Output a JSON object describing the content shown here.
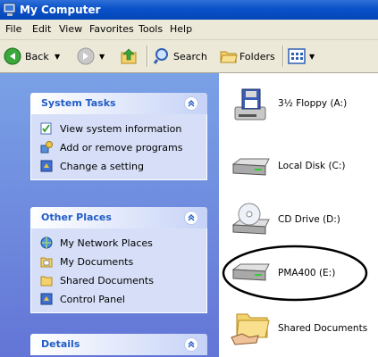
{
  "window": {
    "title": "My Computer"
  },
  "menu": [
    "File",
    "Edit",
    "View",
    "Favorites",
    "Tools",
    "Help"
  ],
  "toolbar": {
    "back": "Back",
    "search": "Search",
    "folders": "Folders"
  },
  "system_tasks": {
    "title": "System Tasks",
    "items": [
      "View system information",
      "Add or remove programs",
      "Change a setting"
    ]
  },
  "other_places": {
    "title": "Other Places",
    "items": [
      "My Network Places",
      "My Documents",
      "Shared Documents",
      "Control Panel"
    ]
  },
  "details": {
    "title": "Details"
  },
  "drives": [
    {
      "label": "3½ Floppy (A:)",
      "icon": "floppy-drive-icon"
    },
    {
      "label": "Local Disk (C:)",
      "icon": "hard-disk-icon"
    },
    {
      "label": "CD Drive (D:)",
      "icon": "cd-drive-icon"
    },
    {
      "label": "PMA400 (E:)",
      "icon": "removable-disk-icon",
      "highlighted": true
    },
    {
      "label": "Shared Documents",
      "icon": "shared-folder-icon"
    }
  ],
  "colors": {
    "titlebar": "#0a52c9",
    "sidebar": "#7aa1e6",
    "panel_heading": "#215dc6",
    "highlight_ring": "#000000"
  }
}
